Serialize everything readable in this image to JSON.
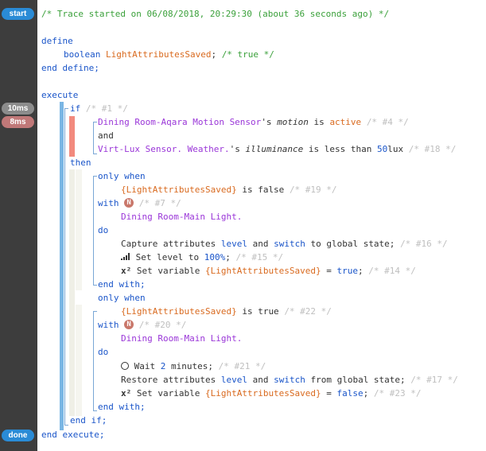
{
  "gutter": {
    "start": "start",
    "t10": "10ms",
    "t8": "8ms",
    "done": "done"
  },
  "code": {
    "trace_comment": "/* Trace started on 06/08/2018, 20:29:30 (about 36 seconds ago) */",
    "define": "define",
    "boolean": "boolean",
    "var_name": "LightAttributesSaved",
    "define_end": ";",
    "init_comment": "/* true */",
    "end_define": "end define;",
    "execute": "execute",
    "if": "if",
    "if_id": "/* #1 */",
    "cond1_device": "Dining Room-Aqara Motion Sensor",
    "cond1_poss": "'s ",
    "cond1_attr": "motion",
    "cond1_is": " is ",
    "cond1_val": "active",
    "cond1_id": "/* #4 */",
    "and": "and",
    "cond2_device": "Virt-Lux Sensor. Weather.",
    "cond2_poss": "'s ",
    "cond2_attr": "illuminance",
    "cond2_op": " is less than ",
    "cond2_num": "50",
    "cond2_unit": "lux",
    "cond2_id": "/* #18 */",
    "then": "then",
    "only_when": "only when",
    "ow1_var": "{LightAttributesSaved}",
    "ow1_op": " is false ",
    "ow1_id": "/* #19 */",
    "with": "with",
    "n_badge": "N",
    "with1_id": "/* #7 */",
    "light": "Dining Room-Main Light.",
    "do": "do",
    "cap_pre": "Capture attributes ",
    "level": "level",
    "and_word": " and ",
    "switch": "switch",
    "cap_post": " to global state; ",
    "cap_id": "/* #16 */",
    "setlevel_pre": " Set level to ",
    "setlevel_val": "100%",
    "setlevel_post": "; ",
    "setlevel_id": "/* #15 */",
    "x2": "x²",
    "setvar_pre": " Set variable ",
    "setvar_var": "{LightAttributesSaved}",
    "setvar_eq": " = ",
    "setvar_true": "true",
    "setvar_semi": "; ",
    "setvar1_id": "/* #14 */",
    "end_with": "end with;",
    "ow2_var": "{LightAttributesSaved}",
    "ow2_op": " is true ",
    "ow2_id": "/* #22 */",
    "with2_id": "/* #20 */",
    "wait_pre": " Wait ",
    "wait_num": "2",
    "wait_post": " minutes; ",
    "wait_id": "/* #21 */",
    "restore_pre": "Restore attributes ",
    "restore_post": " from global state; ",
    "restore_id": "/* #17 */",
    "setvar_false": "false",
    "setvar2_id": "/* #23 */",
    "end_if": "end if;",
    "end_execute": "end execute;"
  },
  "colors": {
    "keyword": "#1a55c9",
    "comment_green": "#3aa03a",
    "comment_gray": "#bfbfbf",
    "device": "#9a36d8",
    "variable": "#d96a1f",
    "gutter": "#3d3d3d",
    "pill_blue": "#2a8bd6",
    "condition_true_bar": "#f28a7e"
  }
}
